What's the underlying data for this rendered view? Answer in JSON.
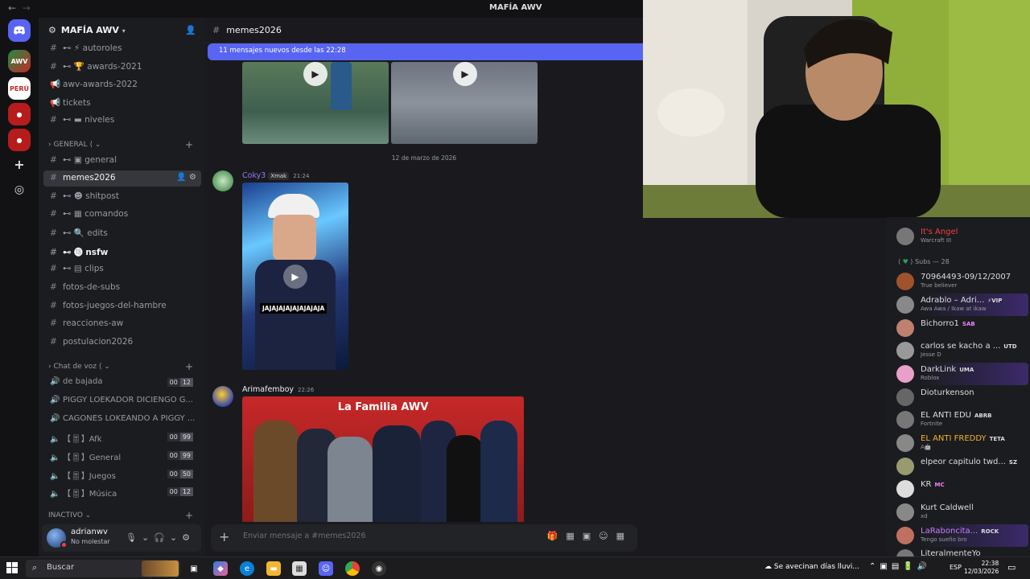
{
  "window": {
    "title": "MAFÍA AWV",
    "back_arrow": "←",
    "fwd_arrow": "→"
  },
  "server": {
    "name": "MAFÍA AWV"
  },
  "channels": [
    {
      "name": "autoroles",
      "emoji": "⚡"
    },
    {
      "name": "awards-2021",
      "emoji": "🏆"
    },
    {
      "name": "awv-awards-2022",
      "emoji": ""
    },
    {
      "name": "tickets",
      "emoji": ""
    },
    {
      "name": "niveles",
      "emoji": ""
    }
  ],
  "category_general": "GENERAL",
  "channels_general": [
    {
      "name": "general"
    },
    {
      "name": "memes2026",
      "active": true
    },
    {
      "name": "shitpost"
    },
    {
      "name": "comandos"
    },
    {
      "name": "edits"
    },
    {
      "name": "nsfw",
      "unread": true
    },
    {
      "name": "clips"
    },
    {
      "name": "fotos-de-subs"
    },
    {
      "name": "fotos-juegos-del-hambre"
    },
    {
      "name": "reacciones-aw"
    },
    {
      "name": "postulacion2026"
    }
  ],
  "category_voice": "Chat de voz",
  "voice_channels": [
    {
      "name": "de bajada",
      "c1": "00",
      "c2": "12"
    },
    {
      "name": "PIGGY LOEKADOR DICIENGO G...",
      "c1": "",
      "c2": ""
    },
    {
      "name": "CAGONES LOKEANDO A PIGGY ...",
      "c1": "",
      "c2": ""
    },
    {
      "name": "【🎚】Afk",
      "c1": "00",
      "c2": "99"
    },
    {
      "name": "【🎚】General",
      "c1": "00",
      "c2": "99"
    },
    {
      "name": "【🎚】Juegos",
      "c1": "00",
      "c2": "50"
    },
    {
      "name": "【🎚】Música",
      "c1": "00",
      "c2": "12"
    }
  ],
  "category_inactive": "INACTIVO",
  "user": {
    "name": "adrianwv",
    "status": "No molestar"
  },
  "chat": {
    "channel_title": "memes2026",
    "new_messages": "11 mensajes nuevos desde las 22:28",
    "date_separator": "12 de marzo de 2026",
    "messages": [
      {
        "author": "Coky3",
        "tag": "Xmak",
        "time": "21:24",
        "caption": "JAJAJAJAJAJAJAJAJA"
      },
      {
        "author": "Arimafemboy",
        "time": "22:26",
        "image_title": "La Familia AWV"
      }
    ],
    "composer_placeholder": "Enviar mensaje a #memes2026"
  },
  "members": {
    "top": {
      "name": "It's Angel",
      "sub": "Warcraft III"
    },
    "group_label": "Subs — 28",
    "list": [
      {
        "name": "70964493-09/12/2007",
        "tag": "",
        "sub": "True believer",
        "color": "#dbdee1"
      },
      {
        "name": "Adrablo – Adri...",
        "tag": "⚡VIP",
        "sub": "Awa Awa / Ikaw at ikaw",
        "color": "#dbdee1",
        "boost": true
      },
      {
        "name": "Bichorro1",
        "tag": "SAB",
        "sub": "",
        "color": "#dbdee1"
      },
      {
        "name": "carlos se kacho a ...",
        "tag": "UTD",
        "sub": "Jesse D",
        "color": "#dbdee1"
      },
      {
        "name": "DarkLink",
        "tag": "UMA",
        "sub": "Roblox",
        "color": "#dbdee1",
        "boost": true
      },
      {
        "name": "Dioturkenson",
        "tag": "",
        "sub": "",
        "color": "#dbdee1"
      },
      {
        "name": "EL ANTI EDU",
        "tag": "ABRB",
        "sub": "Fortnite",
        "color": "#dbdee1"
      },
      {
        "name": "EL ANTI FREDDY",
        "tag": "TETA",
        "sub": "A🤖",
        "color": "#f0b232"
      },
      {
        "name": "elpeor capitulo twd...",
        "tag": "SZ",
        "sub": "",
        "color": "#dbdee1"
      },
      {
        "name": "KR",
        "tag": "MC",
        "sub": "",
        "color": "#dbdee1"
      },
      {
        "name": "Kurt Caldwell",
        "tag": "",
        "sub": "xd",
        "color": "#dbdee1"
      },
      {
        "name": "LaRaboncita...",
        "tag": "ROCK",
        "sub": "Tengo sueño bro",
        "color": "#c77dff",
        "boost": true
      },
      {
        "name": "LiteralmenteYo",
        "tag": "",
        "sub": "",
        "color": "#dbdee1"
      }
    ]
  },
  "taskbar": {
    "search_placeholder": "Buscar",
    "weather": "Se avecinan días lluvi...",
    "lang": "ESP",
    "time": "22:38",
    "date": "12/03/2026"
  }
}
